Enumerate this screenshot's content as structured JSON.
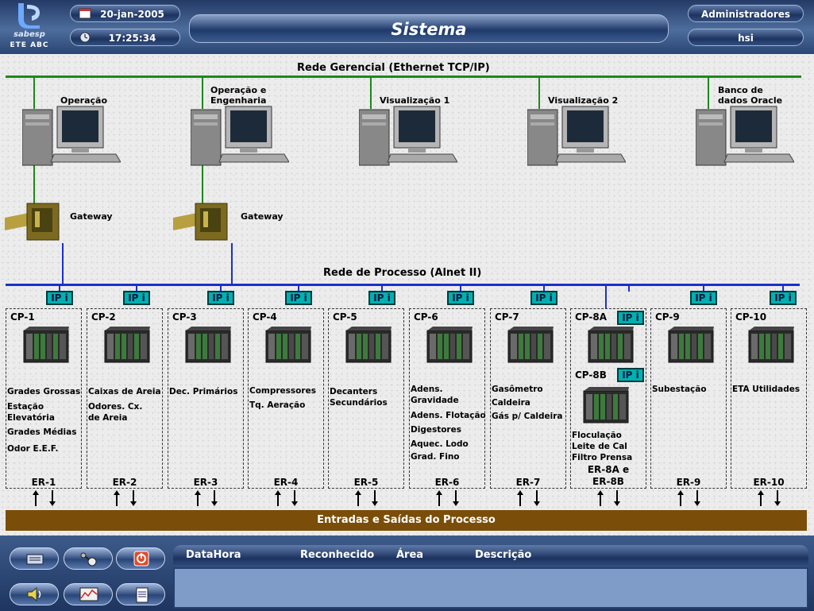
{
  "header": {
    "logo_brand": "sabesp",
    "logo_site": "ETE ABC",
    "date": "20-jan-2005",
    "time": "17:25:34",
    "title": "Sistema",
    "user_group": "Administradores",
    "user": "hsi"
  },
  "networks": {
    "management": "Rede Gerencial  (Ethernet TCP/IP)",
    "process": "Rede de Processo (Alnet II)"
  },
  "workstations": [
    {
      "label": "Operação"
    },
    {
      "label": "Operação e\nEngenharia"
    },
    {
      "label": "Visualização 1"
    },
    {
      "label": "Visualização 2"
    },
    {
      "label": "Banco de\ndados Oracle"
    }
  ],
  "gateways": [
    {
      "label": "Gateway"
    },
    {
      "label": "Gateway"
    }
  ],
  "ip_label": "IP i",
  "controllers": [
    {
      "name": "CP-1",
      "functions": [
        "Grades Grossas",
        "Estação\nElevatória",
        "Grades Médias",
        "Odor E.E.F."
      ],
      "er": "ER-1"
    },
    {
      "name": "CP-2",
      "functions": [
        "Caixas de Areia",
        "Odores. Cx.\nde Areia"
      ],
      "er": "ER-2"
    },
    {
      "name": "CP-3",
      "functions": [
        "Dec. Primários"
      ],
      "er": "ER-3"
    },
    {
      "name": "CP-4",
      "functions": [
        "Compressores",
        "Tq. Aeração"
      ],
      "er": "ER-4"
    },
    {
      "name": "CP-5",
      "functions": [
        "Decanters\nSecundários"
      ],
      "er": "ER-5"
    },
    {
      "name": "CP-6",
      "functions": [
        "Adens.\nGravidade",
        "Adens. Flotação",
        "Digestores",
        "Aquec. Lodo",
        "Grad. Fino"
      ],
      "er": "ER-6"
    },
    {
      "name": "CP-7",
      "functions": [
        "Gasômetro",
        "Caldeira",
        "Gás p/ Caldeira"
      ],
      "er": "ER-7"
    },
    {
      "name": "CP-8A",
      "name2": "CP-8B",
      "functions": [
        "Floculação\nLeite de Cal\nFiltro Prensa"
      ],
      "er": "ER-8A e\nER-8B"
    },
    {
      "name": "CP-9",
      "functions": [
        "Subestação"
      ],
      "er": "ER-9"
    },
    {
      "name": "CP-10",
      "functions": [
        "ETA Utilidades"
      ],
      "er": "ER-10"
    }
  ],
  "io_bar": "Entradas e Saídas do Processo",
  "alarm_table": {
    "columns": [
      "DataHora",
      "Reconhecido",
      "Área",
      "Descrição"
    ]
  },
  "toolbar": [
    "folder-icon",
    "keys-icon",
    "power-icon",
    "speaker-icon",
    "trend-chart-icon",
    "document-icon"
  ],
  "colors": {
    "management_net": "#1a8a1a",
    "process_net": "#1b2fd0",
    "ip_module": "#00b0b0",
    "io_bar": "#7a4d08"
  }
}
